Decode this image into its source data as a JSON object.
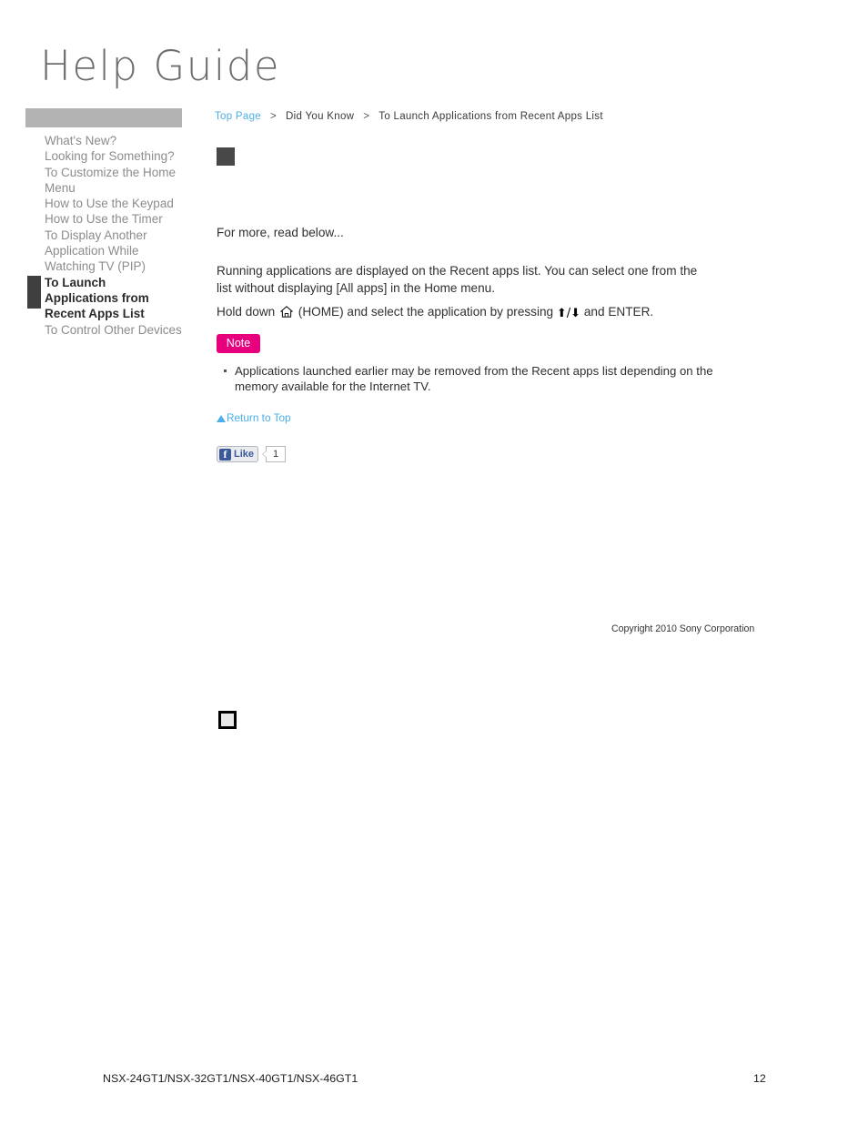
{
  "logo": {
    "text": "Help Guide"
  },
  "sidebar": {
    "items": [
      {
        "label": "What's New?",
        "active": false
      },
      {
        "label": "Looking for Something?",
        "active": false
      },
      {
        "label": "To Customize the Home Menu",
        "active": false
      },
      {
        "label": "How to Use the Keypad",
        "active": false
      },
      {
        "label": "How to Use the Timer",
        "active": false
      },
      {
        "label": "To Display Another Application While Watching TV (PIP)",
        "active": false
      },
      {
        "label": "To Launch Applications from Recent Apps List",
        "active": true
      },
      {
        "label": "To Control Other Devices",
        "active": false
      }
    ]
  },
  "breadcrumb": {
    "top_page": "Top Page",
    "separator_1": ">",
    "section": "Did You Know",
    "separator_2": ">",
    "current": "To Launch Applications from Recent Apps List"
  },
  "content": {
    "read_below": "For more, read below...",
    "paragraph_running": "Running applications are displayed on the Recent apps list. You can select one from the list without displaying [All apps] in the Home menu.",
    "hold_down_prefix": "Hold down",
    "home_label": "(HOME) and select the application by pressing",
    "arrows": "⬆/⬇",
    "hold_down_suffix": "and ENTER.",
    "note_badge": "Note",
    "note_items": [
      "Applications launched earlier may be removed from the Recent apps list depending on the memory available for the Internet TV."
    ],
    "return_to_top": "Return to Top"
  },
  "social": {
    "fb_icon_letter": "f",
    "fb_like_label": "Like",
    "fb_like_count": "1"
  },
  "copyright": {
    "text": "Copyright 2010 Sony Corporation"
  },
  "footer": {
    "models": "NSX-24GT1/NSX-32GT1/NSX-40GT1/NSX-46GT1",
    "page_number": "12"
  },
  "colors": {
    "link_blue": "#4aaee8",
    "note_pink": "#e6007e",
    "sidebar_bar_gray": "#b3b3b3",
    "active_marker_gray": "#3f3f3f",
    "facebook_blue": "#3b5998"
  }
}
